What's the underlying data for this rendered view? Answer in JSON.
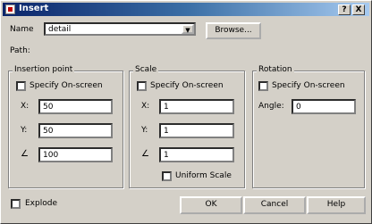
{
  "window": {
    "title": "Insert",
    "help_btn": "?",
    "close_btn": "X"
  },
  "name_row": {
    "label": "Name",
    "value": "detail",
    "browse_label": "Browse..."
  },
  "path": {
    "label": "Path:"
  },
  "insertion": {
    "title": "Insertion point",
    "specify_label": "Specify On-screen",
    "x_label": "X:",
    "x_value": "50",
    "y_label": "Y:",
    "y_value": "50",
    "z_label": "∠",
    "z_value": "100"
  },
  "scale": {
    "title": "Scale",
    "specify_label": "Specify On-screen",
    "x_label": "X:",
    "x_value": "1",
    "y_label": "Y:",
    "y_value": "1",
    "z_label": "∠",
    "z_value": "1",
    "uniform_label": "Uniform Scale"
  },
  "rotation": {
    "title": "Rotation",
    "specify_label": "Specify On-screen",
    "angle_label": "Angle:",
    "angle_value": "0"
  },
  "footer": {
    "explode_label": "Explode",
    "ok": "OK",
    "cancel": "Cancel",
    "help": "Help"
  }
}
